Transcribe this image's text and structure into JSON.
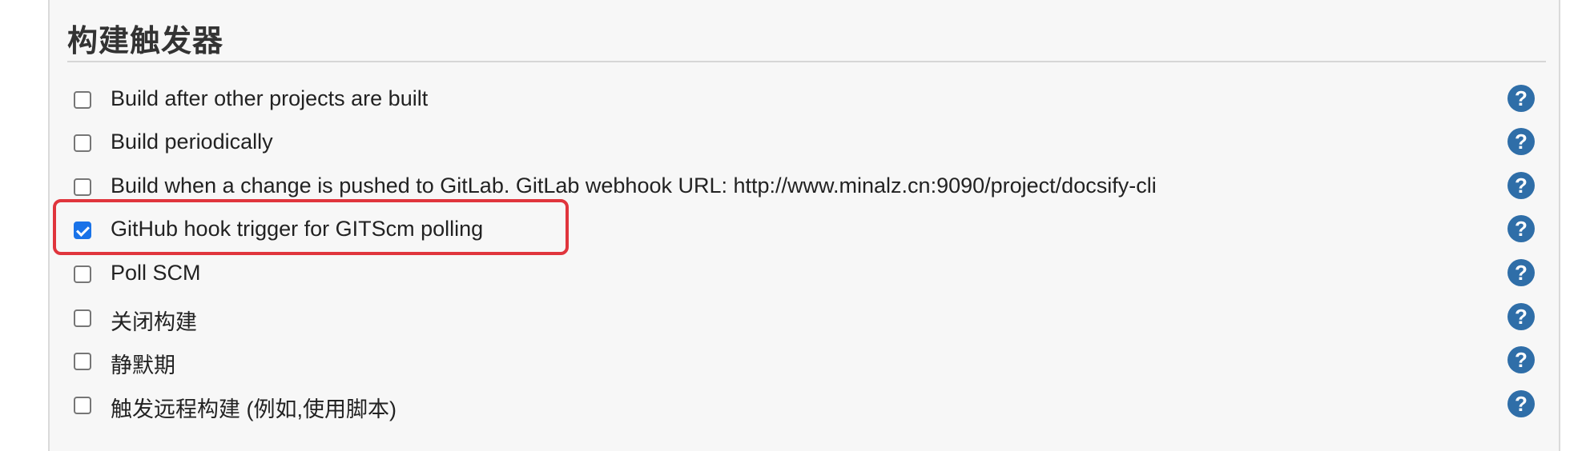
{
  "section": {
    "title": "构建触发器"
  },
  "triggers": [
    {
      "label": "Build after other projects are built",
      "checked": false,
      "help_icon": "?"
    },
    {
      "label": "Build periodically",
      "checked": false,
      "help_icon": "?"
    },
    {
      "label": "Build when a change is pushed to GitLab. GitLab webhook URL: http://www.minalz.cn:9090/project/docsify-cli",
      "checked": false,
      "help_icon": "?"
    },
    {
      "label": "GitHub hook trigger for GITScm polling",
      "checked": true,
      "help_icon": "?"
    },
    {
      "label": "Poll SCM",
      "checked": false,
      "help_icon": "?"
    },
    {
      "label": "关闭构建",
      "checked": false,
      "help_icon": "?"
    },
    {
      "label": "静默期",
      "checked": false,
      "help_icon": "?"
    },
    {
      "label": "触发远程构建 (例如,使用脚本)",
      "checked": false,
      "help_icon": "?"
    }
  ],
  "colors": {
    "checkbox_checked": "#1a73e8",
    "help_icon": "#2f6ea8",
    "highlight_box": "#e0353d"
  },
  "icons": {
    "help": "question-circle-icon",
    "check": "checkmark-icon"
  }
}
